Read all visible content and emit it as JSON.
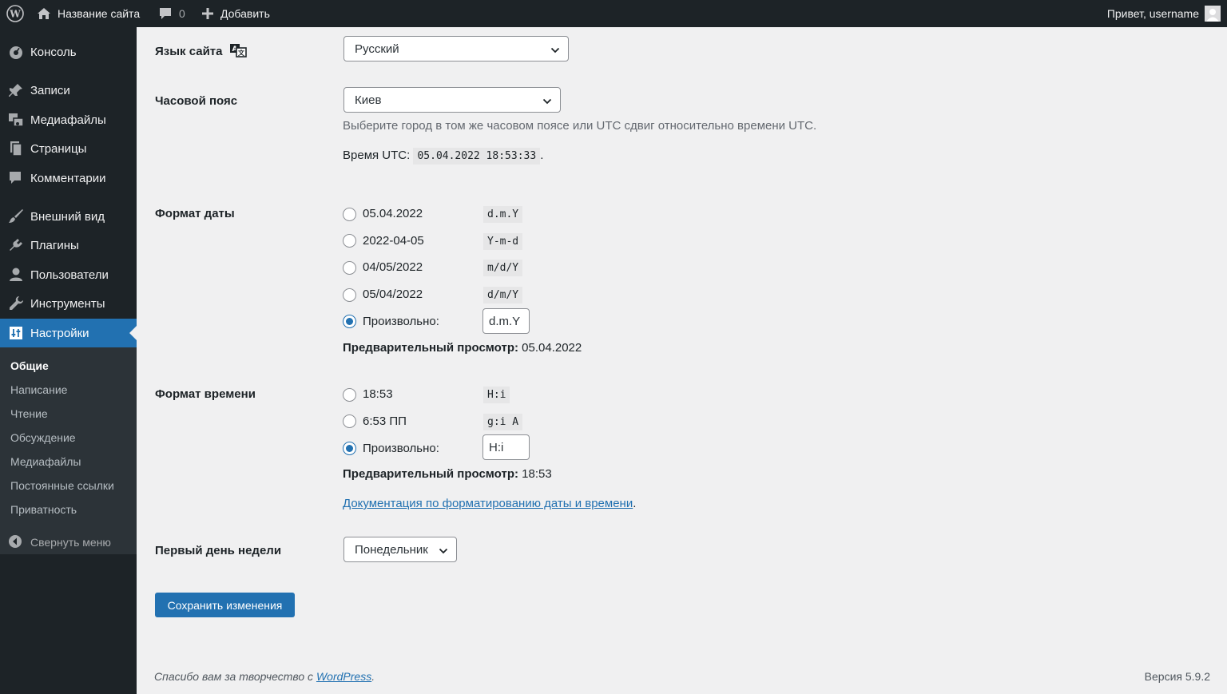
{
  "adminbar": {
    "site_name": "Название сайта",
    "comments_count": "0",
    "add_new": "Добавить",
    "greeting": "Привет, username"
  },
  "sidebar": {
    "items": [
      {
        "label": "Консоль",
        "icon": "dashboard-icon"
      },
      {
        "label": "Записи",
        "icon": "pin-icon"
      },
      {
        "label": "Медиафайлы",
        "icon": "media-icon"
      },
      {
        "label": "Страницы",
        "icon": "pages-icon"
      },
      {
        "label": "Комментарии",
        "icon": "comment-icon"
      },
      {
        "label": "Внешний вид",
        "icon": "brush-icon"
      },
      {
        "label": "Плагины",
        "icon": "plugin-icon"
      },
      {
        "label": "Пользователи",
        "icon": "user-icon"
      },
      {
        "label": "Инструменты",
        "icon": "wrench-icon"
      },
      {
        "label": "Настройки",
        "icon": "settings-icon"
      }
    ],
    "submenu": [
      "Общие",
      "Написание",
      "Чтение",
      "Обсуждение",
      "Медиафайлы",
      "Постоянные ссылки",
      "Приватность"
    ],
    "collapse": "Свернуть меню"
  },
  "language": {
    "label": "Язык сайта",
    "value": "Русский"
  },
  "timezone": {
    "label": "Часовой пояс",
    "value": "Киев",
    "description": "Выберите город в том же часовом поясе или UTC сдвиг относительно времени UTC.",
    "utc_label": "Время UTC:",
    "utc_value": "05.04.2022 18:53:33",
    "utc_suffix": "."
  },
  "date_format": {
    "label": "Формат даты",
    "options": [
      {
        "label": "05.04.2022",
        "code": "d.m.Y"
      },
      {
        "label": "2022-04-05",
        "code": "Y-m-d"
      },
      {
        "label": "04/05/2022",
        "code": "m/d/Y"
      },
      {
        "label": "05/04/2022",
        "code": "d/m/Y"
      }
    ],
    "custom_label": "Произвольно:",
    "custom_value": "d.m.Y",
    "preview_label": "Предварительный просмотр:",
    "preview_value": "05.04.2022"
  },
  "time_format": {
    "label": "Формат времени",
    "options": [
      {
        "label": "18:53",
        "code": "H:i"
      },
      {
        "label": "6:53 ПП",
        "code": "g:i A"
      }
    ],
    "custom_label": "Произвольно:",
    "custom_value": "H:i",
    "preview_label": "Предварительный просмотр:",
    "preview_value": "18:53",
    "doc_link": "Документация по форматированию даты и времени",
    "doc_suffix": "."
  },
  "week": {
    "label": "Первый день недели",
    "value": "Понедельник"
  },
  "save_button": "Сохранить изменения",
  "footer": {
    "thanks_prefix": "Спасибо вам за творчество с ",
    "thanks_link": "WordPress",
    "thanks_suffix": ".",
    "version": "Версия 5.9.2"
  }
}
